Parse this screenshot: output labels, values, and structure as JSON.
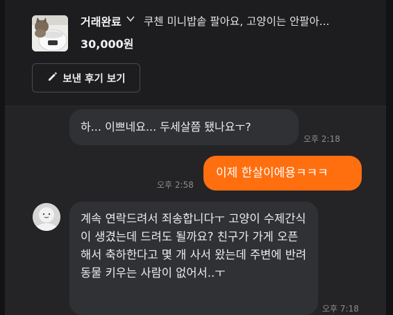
{
  "product": {
    "status_label": "거래완료",
    "title": "쿠첸 미니밥솥 팔아요, 고양이는 안팔아...",
    "price": "30,000원"
  },
  "review_button": {
    "label": "보낸 후기 보기",
    "icon": "pencil-icon"
  },
  "messages": [
    {
      "side": "received",
      "text": "하... 이쁘네요... 두세살쯤 됐나요ㅜ?",
      "time": "오후 2:18"
    },
    {
      "side": "sent",
      "text": "이제 한살이에용ㅋㅋㅋ",
      "time": "오후 2:58"
    },
    {
      "side": "received",
      "text": "계속 연락드려서 죄송합니다ㅜ 고양이 수제간식이 생겼는데 드려도 될까요? 친구가 가게 오픈해서 축하한다고 몇 개 사서 왔는데 주변에 반려동물 키우는 사람이 없어서..ㅜ",
      "time": "오후 7:18"
    }
  ],
  "colors": {
    "background": "#1d1d1f",
    "chat_background": "#242426",
    "received_bubble": "#2f3134",
    "sent_bubble": "#ff6f0f"
  }
}
